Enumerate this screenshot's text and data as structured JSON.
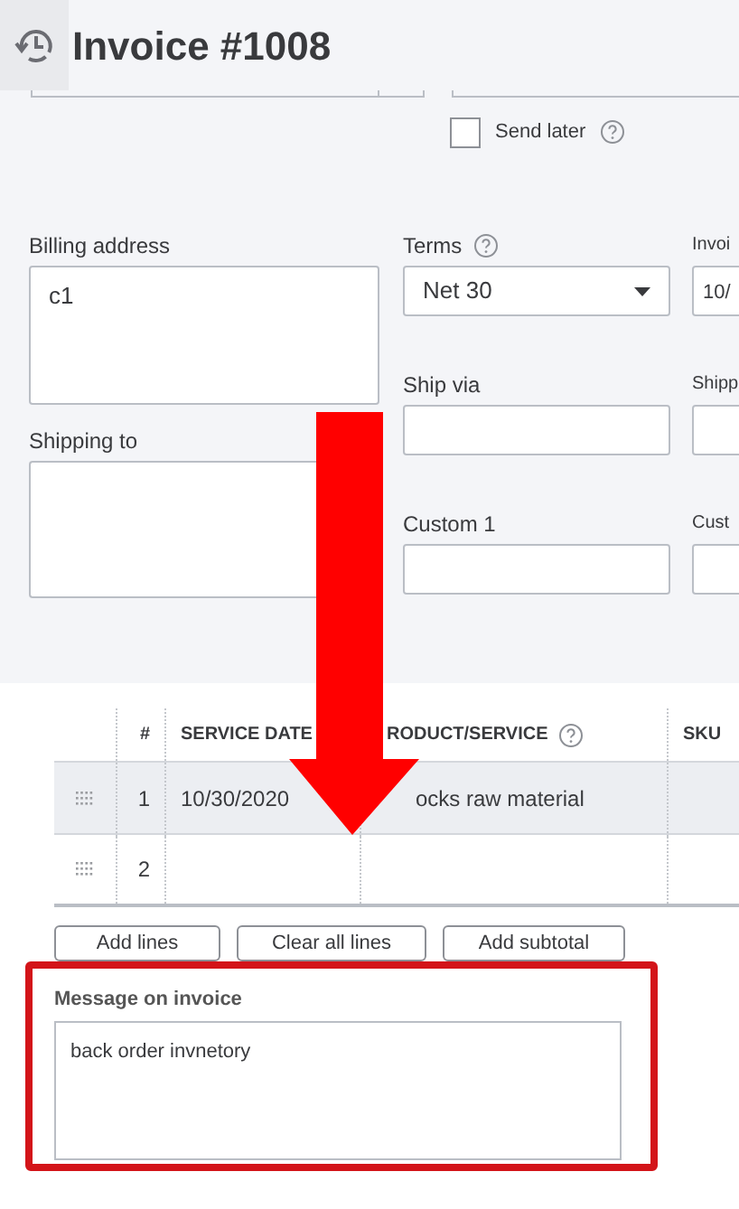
{
  "header": {
    "title": "Invoice #1008"
  },
  "send_later": {
    "label": "Send later",
    "checked": false
  },
  "billing_address": {
    "label": "Billing address",
    "value": "c1"
  },
  "shipping_to": {
    "label": "Shipping to"
  },
  "terms": {
    "label": "Terms",
    "value": "Net 30"
  },
  "ship_via": {
    "label": "Ship via"
  },
  "custom_1": {
    "label": "Custom 1"
  },
  "column_3_fields": [
    {
      "label": "Invoi",
      "value": "10/"
    },
    {
      "label": "Shipp"
    },
    {
      "label": "Cust"
    }
  ],
  "table": {
    "columns": [
      "#",
      "SERVICE DATE",
      "RODUCT/SERVICE",
      "SKU"
    ],
    "rows": [
      {
        "number": "1",
        "service_date": "10/30/2020",
        "product": "ocks raw material",
        "selected": true
      },
      {
        "number": "2",
        "selected": false
      }
    ]
  },
  "buttons": [
    "Add lines",
    "Clear all lines",
    "Add subtotal"
  ],
  "message": {
    "label": "Message on invoice",
    "value": "back order invnetory"
  }
}
